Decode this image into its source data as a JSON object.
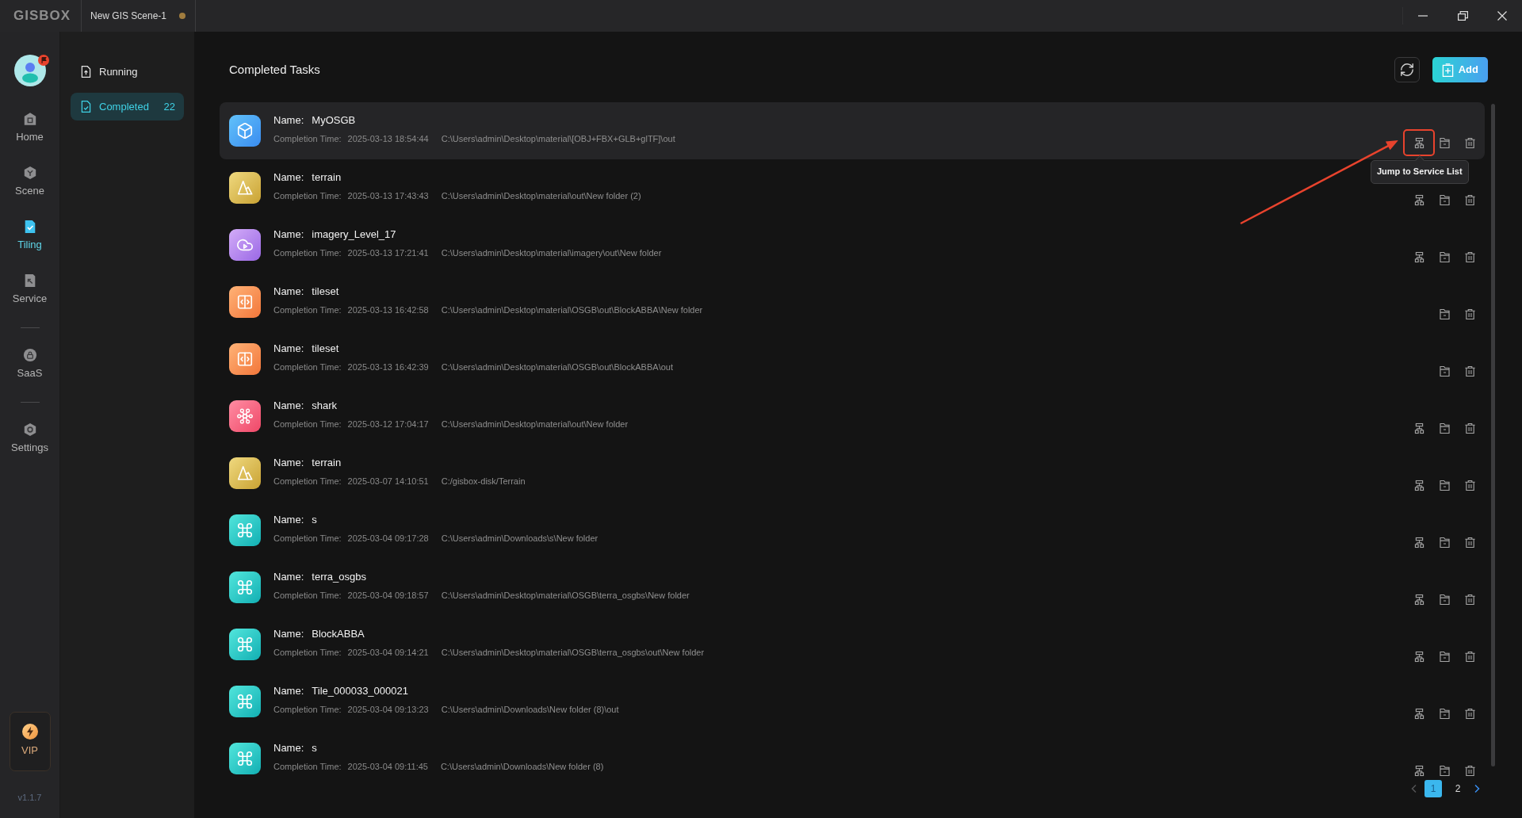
{
  "title_bar": {
    "logo": "GISBOX",
    "tab": {
      "label": "New GIS Scene-1",
      "unsaved": true
    }
  },
  "rail": {
    "avatar": {
      "notification": true
    },
    "nav_groups": [
      [
        {
          "label": "Home",
          "kind": "home",
          "selected": false
        },
        {
          "label": "Scene",
          "kind": "scene",
          "selected": false
        },
        {
          "label": "Tiling",
          "kind": "tiling",
          "selected": true
        },
        {
          "label": "Service",
          "kind": "service",
          "selected": false
        }
      ],
      [
        {
          "label": "SaaS",
          "kind": "saas",
          "selected": false
        }
      ],
      [
        {
          "label": "Settings",
          "kind": "settings",
          "selected": false
        }
      ]
    ],
    "vip": {
      "label": "VIP"
    },
    "version": "v1.1.7"
  },
  "subnav": {
    "items": [
      {
        "label": "Running",
        "kind": "upload",
        "selected": false
      },
      {
        "label": "Completed",
        "kind": "check",
        "selected": true,
        "count": "22"
      }
    ]
  },
  "main": {
    "title": "Completed Tasks",
    "add_button": {
      "label": "Add"
    },
    "tasks": [
      {
        "kind": "cube",
        "hovered": true,
        "name_label": "Name:",
        "name": "MyOSGB",
        "time_label": "Completion Time:",
        "time": "2025-03-13 18:54:44",
        "path": "C:\\Users\\admin\\Desktop\\material\\[OBJ+FBX+GLB+glTF]\\out",
        "actions": [
          {
            "kind": "service",
            "tooltip": "Jump to Service List",
            "annotated": true
          },
          {
            "kind": "archive"
          },
          {
            "kind": "delete"
          }
        ]
      },
      {
        "kind": "mountain",
        "hovered": false,
        "name_label": "Name:",
        "name": "terrain",
        "time_label": "Completion Time:",
        "time": "2025-03-13 17:43:43",
        "path": "C:\\Users\\admin\\Desktop\\material\\out\\New folder (2)",
        "actions": [
          {
            "kind": "service"
          },
          {
            "kind": "archive"
          },
          {
            "kind": "delete"
          }
        ]
      },
      {
        "kind": "cloud",
        "hovered": false,
        "name_label": "Name:",
        "name": "imagery_Level_17",
        "time_label": "Completion Time:",
        "time": "2025-03-13 17:21:41",
        "path": "C:\\Users\\admin\\Desktop\\material\\imagery\\out\\New folder",
        "actions": [
          {
            "kind": "service"
          },
          {
            "kind": "archive"
          },
          {
            "kind": "delete"
          }
        ]
      },
      {
        "kind": "split",
        "hovered": false,
        "name_label": "Name:",
        "name": "tileset",
        "time_label": "Completion Time:",
        "time": "2025-03-13 16:42:58",
        "path": "C:\\Users\\admin\\Desktop\\material\\OSGB\\out\\BlockABBA\\New folder",
        "actions": [
          {
            "kind": "archive"
          },
          {
            "kind": "delete"
          }
        ]
      },
      {
        "kind": "split",
        "hovered": false,
        "name_label": "Name:",
        "name": "tileset",
        "time_label": "Completion Time:",
        "time": "2025-03-13 16:42:39",
        "path": "C:\\Users\\admin\\Desktop\\material\\OSGB\\out\\BlockABBA\\out",
        "actions": [
          {
            "kind": "archive"
          },
          {
            "kind": "delete"
          }
        ]
      },
      {
        "kind": "molecule",
        "hovered": false,
        "name_label": "Name:",
        "name": "shark",
        "time_label": "Completion Time:",
        "time": "2025-03-12 17:04:17",
        "path": "C:\\Users\\admin\\Desktop\\material\\out\\New folder",
        "actions": [
          {
            "kind": "service"
          },
          {
            "kind": "archive"
          },
          {
            "kind": "delete"
          }
        ]
      },
      {
        "kind": "mountain",
        "hovered": false,
        "name_label": "Name:",
        "name": "terrain",
        "time_label": "Completion Time:",
        "time": "2025-03-07 14:10:51",
        "path": "C:/gisbox-disk/Terrain",
        "actions": [
          {
            "kind": "service"
          },
          {
            "kind": "archive"
          },
          {
            "kind": "delete"
          }
        ]
      },
      {
        "kind": "command",
        "hovered": false,
        "name_label": "Name:",
        "name": "s",
        "time_label": "Completion Time:",
        "time": "2025-03-04 09:17:28",
        "path": "C:\\Users\\admin\\Downloads\\s\\New folder",
        "actions": [
          {
            "kind": "service"
          },
          {
            "kind": "archive"
          },
          {
            "kind": "delete"
          }
        ]
      },
      {
        "kind": "command",
        "hovered": false,
        "name_label": "Name:",
        "name": "terra_osgbs",
        "time_label": "Completion Time:",
        "time": "2025-03-04 09:18:57",
        "path": "C:\\Users\\admin\\Desktop\\material\\OSGB\\terra_osgbs\\New folder",
        "actions": [
          {
            "kind": "service"
          },
          {
            "kind": "archive"
          },
          {
            "kind": "delete"
          }
        ]
      },
      {
        "kind": "command",
        "hovered": false,
        "name_label": "Name:",
        "name": "BlockABBA",
        "time_label": "Completion Time:",
        "time": "2025-03-04 09:14:21",
        "path": "C:\\Users\\admin\\Desktop\\material\\OSGB\\terra_osgbs\\out\\New folder",
        "actions": [
          {
            "kind": "service"
          },
          {
            "kind": "archive"
          },
          {
            "kind": "delete"
          }
        ]
      },
      {
        "kind": "command",
        "hovered": false,
        "name_label": "Name:",
        "name": "Tile_000033_000021",
        "time_label": "Completion Time:",
        "time": "2025-03-04 09:13:23",
        "path": "C:\\Users\\admin\\Downloads\\New folder (8)\\out",
        "actions": [
          {
            "kind": "service"
          },
          {
            "kind": "archive"
          },
          {
            "kind": "delete"
          }
        ]
      },
      {
        "kind": "command",
        "hovered": false,
        "name_label": "Name:",
        "name": "s",
        "time_label": "Completion Time:",
        "time": "2025-03-04 09:11:45",
        "path": "C:\\Users\\admin\\Downloads\\New folder (8)",
        "actions": [
          {
            "kind": "service"
          },
          {
            "kind": "archive"
          },
          {
            "kind": "delete"
          }
        ]
      }
    ],
    "pagination": {
      "prev": {
        "disabled": true
      },
      "pages": [
        {
          "label": "1",
          "selected": true
        },
        {
          "label": "2",
          "selected": false
        }
      ],
      "next": {
        "disabled": false
      }
    }
  }
}
